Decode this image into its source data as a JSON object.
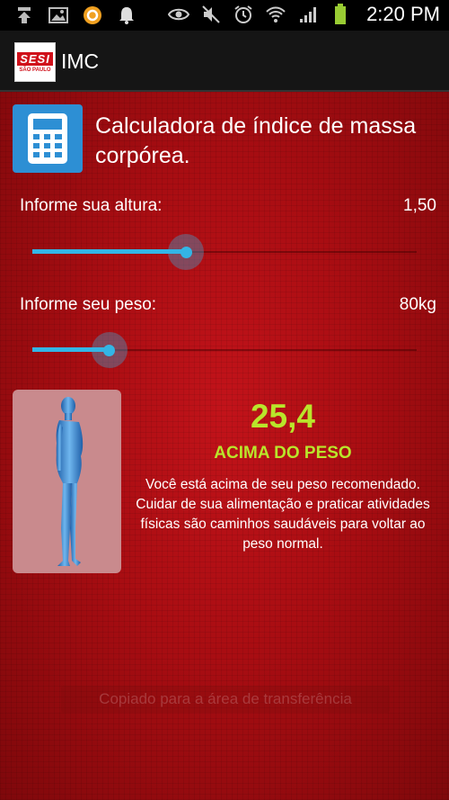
{
  "status_bar": {
    "time": "2:20 PM",
    "left_icons": [
      "download-icon",
      "image-icon",
      "app-notification-icon",
      "bell-icon"
    ],
    "right_icons": [
      "eye-icon",
      "mute-icon",
      "alarm-icon",
      "wifi-icon",
      "signal-icon",
      "battery-icon"
    ]
  },
  "action_bar": {
    "logo_main": "SESI",
    "logo_sub": "SÃO PAULO",
    "title": "IMC"
  },
  "header": {
    "icon": "calculator-icon",
    "title": "Calculadora de índice de massa corpórea."
  },
  "height": {
    "label": "Informe sua altura:",
    "value": "1,50",
    "slider_fraction": 0.4
  },
  "weight": {
    "label": "Informe seu peso:",
    "value": "80kg",
    "slider_fraction": 0.2
  },
  "result": {
    "figure_icon": "body-figure-icon",
    "bmi": "25,4",
    "classification": "ACIMA DO PESO",
    "description": "Você está acima de seu peso recomendado. Cuidar de sua alimentação e praticar atividades físicas são caminhos saudáveis para voltar ao peso normal."
  },
  "toast": {
    "text": "Copiado para a área de transferência"
  },
  "colors": {
    "accent": "#33b5e5",
    "result": "#b9e52b",
    "background": "#a80d12",
    "brand": "#d0101a"
  }
}
